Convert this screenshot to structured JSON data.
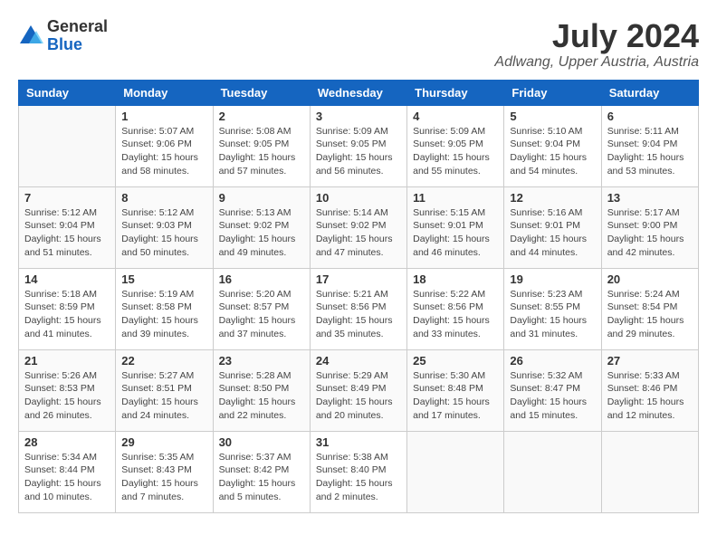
{
  "header": {
    "logo_general": "General",
    "logo_blue": "Blue",
    "month_year": "July 2024",
    "location": "Adlwang, Upper Austria, Austria"
  },
  "weekdays": [
    "Sunday",
    "Monday",
    "Tuesday",
    "Wednesday",
    "Thursday",
    "Friday",
    "Saturday"
  ],
  "weeks": [
    [
      {
        "day": "",
        "info": ""
      },
      {
        "day": "1",
        "info": "Sunrise: 5:07 AM\nSunset: 9:06 PM\nDaylight: 15 hours\nand 58 minutes."
      },
      {
        "day": "2",
        "info": "Sunrise: 5:08 AM\nSunset: 9:05 PM\nDaylight: 15 hours\nand 57 minutes."
      },
      {
        "day": "3",
        "info": "Sunrise: 5:09 AM\nSunset: 9:05 PM\nDaylight: 15 hours\nand 56 minutes."
      },
      {
        "day": "4",
        "info": "Sunrise: 5:09 AM\nSunset: 9:05 PM\nDaylight: 15 hours\nand 55 minutes."
      },
      {
        "day": "5",
        "info": "Sunrise: 5:10 AM\nSunset: 9:04 PM\nDaylight: 15 hours\nand 54 minutes."
      },
      {
        "day": "6",
        "info": "Sunrise: 5:11 AM\nSunset: 9:04 PM\nDaylight: 15 hours\nand 53 minutes."
      }
    ],
    [
      {
        "day": "7",
        "info": "Sunrise: 5:12 AM\nSunset: 9:04 PM\nDaylight: 15 hours\nand 51 minutes."
      },
      {
        "day": "8",
        "info": "Sunrise: 5:12 AM\nSunset: 9:03 PM\nDaylight: 15 hours\nand 50 minutes."
      },
      {
        "day": "9",
        "info": "Sunrise: 5:13 AM\nSunset: 9:02 PM\nDaylight: 15 hours\nand 49 minutes."
      },
      {
        "day": "10",
        "info": "Sunrise: 5:14 AM\nSunset: 9:02 PM\nDaylight: 15 hours\nand 47 minutes."
      },
      {
        "day": "11",
        "info": "Sunrise: 5:15 AM\nSunset: 9:01 PM\nDaylight: 15 hours\nand 46 minutes."
      },
      {
        "day": "12",
        "info": "Sunrise: 5:16 AM\nSunset: 9:01 PM\nDaylight: 15 hours\nand 44 minutes."
      },
      {
        "day": "13",
        "info": "Sunrise: 5:17 AM\nSunset: 9:00 PM\nDaylight: 15 hours\nand 42 minutes."
      }
    ],
    [
      {
        "day": "14",
        "info": "Sunrise: 5:18 AM\nSunset: 8:59 PM\nDaylight: 15 hours\nand 41 minutes."
      },
      {
        "day": "15",
        "info": "Sunrise: 5:19 AM\nSunset: 8:58 PM\nDaylight: 15 hours\nand 39 minutes."
      },
      {
        "day": "16",
        "info": "Sunrise: 5:20 AM\nSunset: 8:57 PM\nDaylight: 15 hours\nand 37 minutes."
      },
      {
        "day": "17",
        "info": "Sunrise: 5:21 AM\nSunset: 8:56 PM\nDaylight: 15 hours\nand 35 minutes."
      },
      {
        "day": "18",
        "info": "Sunrise: 5:22 AM\nSunset: 8:56 PM\nDaylight: 15 hours\nand 33 minutes."
      },
      {
        "day": "19",
        "info": "Sunrise: 5:23 AM\nSunset: 8:55 PM\nDaylight: 15 hours\nand 31 minutes."
      },
      {
        "day": "20",
        "info": "Sunrise: 5:24 AM\nSunset: 8:54 PM\nDaylight: 15 hours\nand 29 minutes."
      }
    ],
    [
      {
        "day": "21",
        "info": "Sunrise: 5:26 AM\nSunset: 8:53 PM\nDaylight: 15 hours\nand 26 minutes."
      },
      {
        "day": "22",
        "info": "Sunrise: 5:27 AM\nSunset: 8:51 PM\nDaylight: 15 hours\nand 24 minutes."
      },
      {
        "day": "23",
        "info": "Sunrise: 5:28 AM\nSunset: 8:50 PM\nDaylight: 15 hours\nand 22 minutes."
      },
      {
        "day": "24",
        "info": "Sunrise: 5:29 AM\nSunset: 8:49 PM\nDaylight: 15 hours\nand 20 minutes."
      },
      {
        "day": "25",
        "info": "Sunrise: 5:30 AM\nSunset: 8:48 PM\nDaylight: 15 hours\nand 17 minutes."
      },
      {
        "day": "26",
        "info": "Sunrise: 5:32 AM\nSunset: 8:47 PM\nDaylight: 15 hours\nand 15 minutes."
      },
      {
        "day": "27",
        "info": "Sunrise: 5:33 AM\nSunset: 8:46 PM\nDaylight: 15 hours\nand 12 minutes."
      }
    ],
    [
      {
        "day": "28",
        "info": "Sunrise: 5:34 AM\nSunset: 8:44 PM\nDaylight: 15 hours\nand 10 minutes."
      },
      {
        "day": "29",
        "info": "Sunrise: 5:35 AM\nSunset: 8:43 PM\nDaylight: 15 hours\nand 7 minutes."
      },
      {
        "day": "30",
        "info": "Sunrise: 5:37 AM\nSunset: 8:42 PM\nDaylight: 15 hours\nand 5 minutes."
      },
      {
        "day": "31",
        "info": "Sunrise: 5:38 AM\nSunset: 8:40 PM\nDaylight: 15 hours\nand 2 minutes."
      },
      {
        "day": "",
        "info": ""
      },
      {
        "day": "",
        "info": ""
      },
      {
        "day": "",
        "info": ""
      }
    ]
  ]
}
